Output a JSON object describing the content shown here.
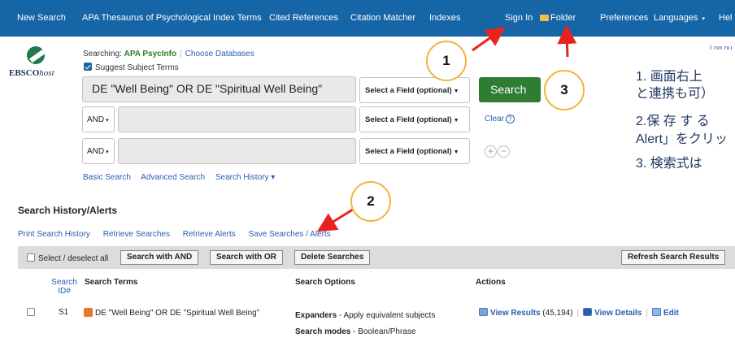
{
  "nav": {
    "new_search": "New Search",
    "thesaurus": "APA Thesaurus of Psychological Index Terms",
    "cited_refs": "Cited References",
    "citation_matcher": "Citation Matcher",
    "indexes": "Indexes",
    "sign_in": "Sign In",
    "folder": "Folder",
    "preferences": "Preferences",
    "languages": "Languages",
    "languages_caret": "▾",
    "help": "Hel"
  },
  "logo": {
    "brand": "EBSCO",
    "suffix": "host"
  },
  "logout": "Log ou",
  "searching": {
    "label": "Searching: ",
    "db": "APA PsycInfo",
    "choose": "Choose Databases",
    "suggest": "Suggest Subject Terms"
  },
  "query": {
    "row1": "DE \"Well Being\" OR DE \"Spiritual Well Being\"",
    "bool": "AND",
    "field": "Select a Field (optional)",
    "search": "Search",
    "clear": "Clear",
    "help": "?"
  },
  "sublinks": {
    "basic": "Basic Search",
    "advanced": "Advanced Search",
    "history": "Search History ▾"
  },
  "history": {
    "title": "Search History/Alerts",
    "links": [
      "Print Search History",
      "Retrieve Searches",
      "Retrieve Alerts",
      "Save Searches / Alerts"
    ],
    "select_all": "Select / deselect all",
    "btn_and": "Search with AND",
    "btn_or": "Search with OR",
    "btn_delete": "Delete Searches",
    "btn_refresh": "Refresh Search Results",
    "headers": {
      "id_1": "Search",
      "id_2": "ID#",
      "terms": "Search Terms",
      "options": "Search Options",
      "actions": "Actions"
    },
    "row": {
      "id": "S1",
      "terms": "DE \"Well Being\" OR DE \"Spiritual Well Being\"",
      "expanders_label": "Expanders",
      "expanders_value": " - Apply equivalent subjects",
      "modes_label": "Search modes",
      "modes_value": " - Boolean/Phrase",
      "view_results": "View Results",
      "count": "(45,194)",
      "view_details": "View Details",
      "edit": "Edit"
    }
  },
  "annotations": {
    "c1": "1",
    "c2": "2",
    "c3": "3",
    "note1a": "1. 画面右上",
    "note1b": "と連携も可）",
    "note2a": "2.保 存 す る",
    "note2b": "Alert」をクリッ",
    "note3": "3. 検索式は",
    "color": "#e8231f"
  }
}
